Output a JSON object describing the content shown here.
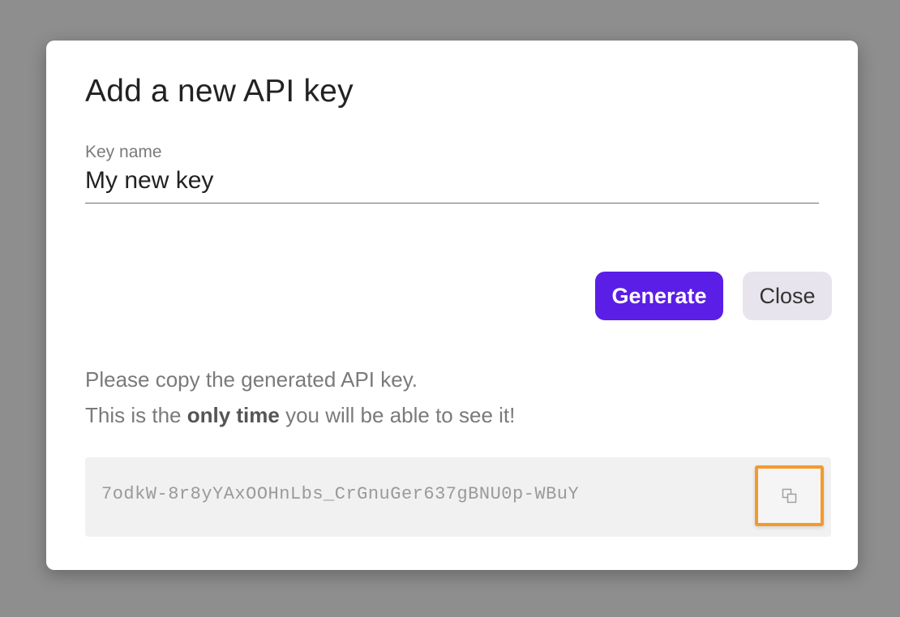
{
  "dialog": {
    "title": "Add a new API key",
    "field": {
      "label": "Key name",
      "value": "My new key"
    },
    "buttons": {
      "generate_label": "Generate",
      "close_label": "Close"
    },
    "info": {
      "line1": "Please copy the generated API key.",
      "line2_prefix": "This is the ",
      "line2_bold": "only time",
      "line2_suffix": " you will be able to see it!"
    },
    "generated_key": "7odkW-8r8yYAxOOHnLbs_CrGnuGer637gBNU0p-WBuY"
  },
  "colors": {
    "primary": "#5b1ee6",
    "secondary_button": "#e7e4ee",
    "highlight": "#f39a2d",
    "backdrop": "#8e8e8e"
  },
  "icons": {
    "copy": "copy-icon"
  }
}
